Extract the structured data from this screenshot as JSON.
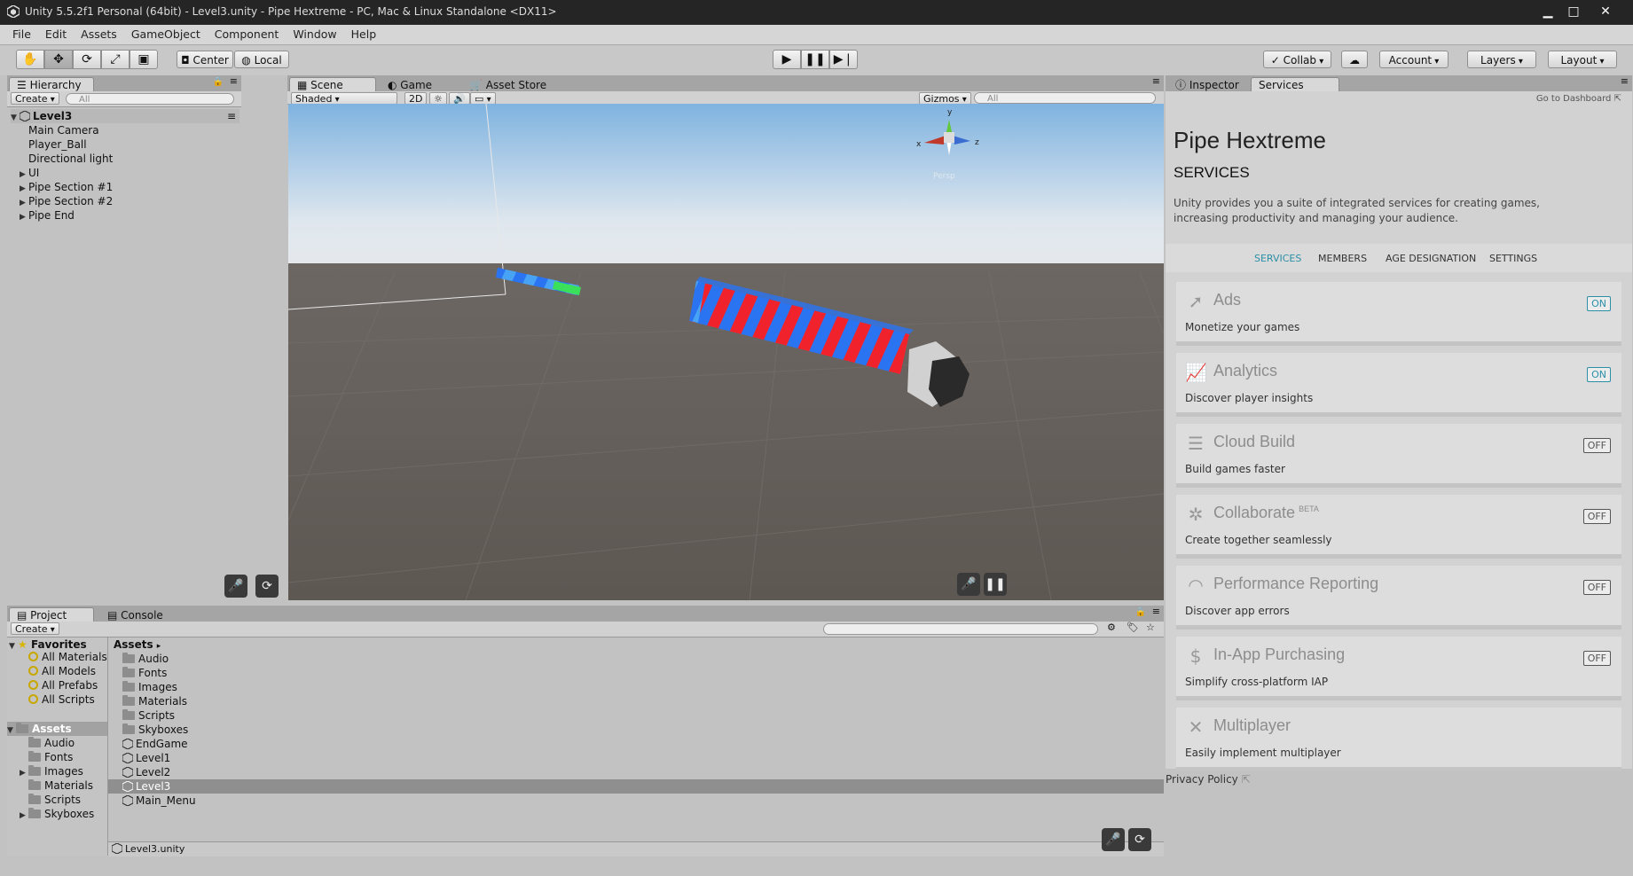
{
  "window": {
    "title": "Unity 5.5.2f1 Personal (64bit) - Level3.unity - Pipe Hextreme - PC, Mac & Linux Standalone <DX11>",
    "minimize": "▁",
    "maximize": "□",
    "close": "✕"
  },
  "menu": [
    "File",
    "Edit",
    "Assets",
    "GameObject",
    "Component",
    "Window",
    "Help"
  ],
  "toolbar": {
    "pivot": "Center",
    "space": "Local",
    "collab": "Collab",
    "account": "Account",
    "layers": "Layers",
    "layout": "Layout"
  },
  "hierarchy": {
    "tab": "Hierarchy",
    "create": "Create",
    "search_placeholder": "All",
    "scene": "Level3",
    "items": [
      {
        "label": "Main Camera",
        "expandable": false
      },
      {
        "label": "Player_Ball",
        "expandable": false
      },
      {
        "label": "Directional light",
        "expandable": false
      },
      {
        "label": "UI",
        "expandable": true
      },
      {
        "label": "Pipe Section #1",
        "expandable": true
      },
      {
        "label": "Pipe Section #2",
        "expandable": true
      },
      {
        "label": "Pipe End",
        "expandable": true
      }
    ]
  },
  "scene_tabs": {
    "scene": "Scene",
    "game": "Game",
    "asset_store": "Asset Store"
  },
  "scene_bar": {
    "shading": "Shaded",
    "mode_2d": "2D",
    "gizmos": "Gizmos",
    "search_placeholder": "All"
  },
  "gizmo": {
    "x": "x",
    "y": "y",
    "z": "z",
    "persp": "Persp"
  },
  "inspector_tabs": {
    "inspector": "Inspector",
    "services": "Services"
  },
  "services": {
    "dashboard_link": "Go to Dashboard",
    "project_name": "Pipe Hextreme",
    "heading": "SERVICES",
    "intro": "Unity provides you a suite of integrated services for creating games, increasing productivity and managing your audience.",
    "nav": [
      "SERVICES",
      "MEMBERS",
      "AGE DESIGNATION",
      "SETTINGS"
    ],
    "cards": [
      {
        "name": "Ads",
        "desc": "Monetize your games",
        "toggle": "ON",
        "icon": "ads-icon"
      },
      {
        "name": "Analytics",
        "desc": "Discover player insights",
        "toggle": "ON",
        "icon": "analytics-icon"
      },
      {
        "name": "Cloud Build",
        "desc": "Build games faster",
        "toggle": "OFF",
        "icon": "cloud-build-icon"
      },
      {
        "name": "Collaborate",
        "badge": "BETA",
        "desc": "Create together seamlessly",
        "toggle": "OFF",
        "icon": "collaborate-icon"
      },
      {
        "name": "Performance Reporting",
        "desc": "Discover app errors",
        "toggle": "OFF",
        "icon": "performance-icon"
      },
      {
        "name": "In-App Purchasing",
        "desc": "Simplify cross-platform IAP",
        "toggle": "OFF",
        "icon": "dollar-icon"
      },
      {
        "name": "Multiplayer",
        "desc": "Easily implement multiplayer",
        "toggle": "",
        "icon": "multiplayer-icon"
      }
    ],
    "privacy": "Privacy Policy"
  },
  "project": {
    "tab": "Project",
    "console_tab": "Console",
    "create": "Create",
    "favorites": "Favorites",
    "favorite_items": [
      "All Materials",
      "All Models",
      "All Prefabs",
      "All Scripts"
    ],
    "assets_root": "Assets",
    "tree_folders": [
      {
        "label": "Audio",
        "expandable": false
      },
      {
        "label": "Fonts",
        "expandable": false
      },
      {
        "label": "Images",
        "expandable": true
      },
      {
        "label": "Materials",
        "expandable": false
      },
      {
        "label": "Scripts",
        "expandable": false
      },
      {
        "label": "Skyboxes",
        "expandable": true
      }
    ],
    "breadcrumb": "Assets",
    "list": [
      {
        "label": "Audio",
        "type": "folder"
      },
      {
        "label": "Fonts",
        "type": "folder"
      },
      {
        "label": "Images",
        "type": "folder"
      },
      {
        "label": "Materials",
        "type": "folder"
      },
      {
        "label": "Scripts",
        "type": "folder"
      },
      {
        "label": "Skyboxes",
        "type": "folder"
      },
      {
        "label": "EndGame",
        "type": "scene"
      },
      {
        "label": "Level1",
        "type": "scene"
      },
      {
        "label": "Level2",
        "type": "scene"
      },
      {
        "label": "Level3",
        "type": "scene",
        "selected": true
      },
      {
        "label": "Main_Menu",
        "type": "scene"
      }
    ],
    "footer_path": "Level3.unity"
  }
}
